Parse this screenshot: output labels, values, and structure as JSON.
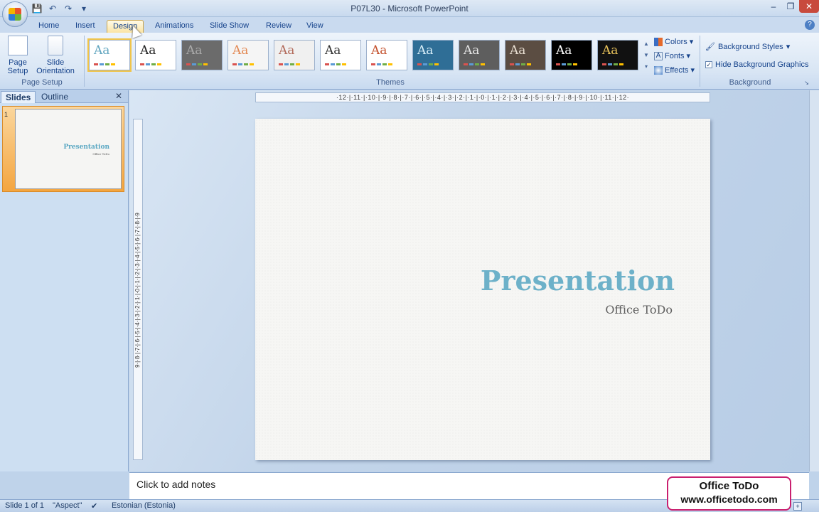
{
  "window": {
    "title": "P07L30 - Microsoft PowerPoint",
    "controls": [
      "minimize",
      "restore",
      "close"
    ]
  },
  "quick_access": [
    "save-icon",
    "undo-icon",
    "redo-icon",
    "customize-icon"
  ],
  "tabs": [
    {
      "label": "Home"
    },
    {
      "label": "Insert"
    },
    {
      "label": "Design",
      "active": true
    },
    {
      "label": "Animations"
    },
    {
      "label": "Slide Show"
    },
    {
      "label": "Review"
    },
    {
      "label": "View"
    }
  ],
  "ribbon": {
    "page_setup": {
      "group_label": "Page Setup",
      "page_setup_label": "Page Setup",
      "orientation_label": "Slide Orientation"
    },
    "themes": {
      "group_label": "Themes",
      "sample": "Aa",
      "selected_index": 0,
      "items": [
        {
          "bg": "#ffffff",
          "fg": "#62a6c0"
        },
        {
          "bg": "#ffffff",
          "fg": "#222222"
        },
        {
          "bg": "#6b6b6b",
          "fg": "#aaaaaa"
        },
        {
          "bg": "#f5f5f5",
          "fg": "#e38a55"
        },
        {
          "bg": "#f0f0f0",
          "fg": "#b26a5a"
        },
        {
          "bg": "#ffffff",
          "fg": "#333333"
        },
        {
          "bg": "#ffffff",
          "fg": "#c3502c"
        },
        {
          "bg": "#2f6e96",
          "fg": "#d8eef8"
        },
        {
          "bg": "#5e5e5e",
          "fg": "#e6e6e6"
        },
        {
          "bg": "#5b4d42",
          "fg": "#e9dfd2"
        },
        {
          "bg": "#000000",
          "fg": "#ffffff"
        },
        {
          "bg": "#111111",
          "fg": "#e8c25a"
        }
      ]
    },
    "colors_label": "Colors",
    "fonts_label": "Fonts",
    "effects_label": "Effects",
    "background": {
      "group_label": "Background",
      "styles_label": "Background Styles",
      "hide_graphics_label": "Hide Background Graphics",
      "hide_graphics_checked": true
    }
  },
  "left_pane": {
    "tab_slides": "Slides",
    "tab_outline": "Outline",
    "thumbnail_number": "1",
    "thumbnail_title": "Presentation",
    "thumbnail_subtitle": "Office ToDo"
  },
  "rulers": {
    "horizontal": "·12·|·11·|·10·|·9·|·8·|·7·|·6·|·5·|·4·|·3·|·2·|·1·|·0·|·1·|·2·|·3·|·4·|·5·|·6·|·7·|·8·|·9·|·10·|·11·|·12·",
    "vertical": "9·|·8·|·7·|·6·|·5·|·4·|·3·|·2·|·1·|·0·|·1·|·2·|·3·|·4·|·5·|·6·|·7·|·8·|·9"
  },
  "slide": {
    "title": "Presentation",
    "subtitle": "Office ToDo"
  },
  "notes_placeholder": "Click to add notes",
  "status": {
    "slide_info": "Slide 1 of 1",
    "theme_name": "\"Aspect\"",
    "language": "Estonian (Estonia)"
  },
  "watermark": {
    "line1": "Office ToDo",
    "line2": "www.officetodo.com"
  },
  "colors": {
    "accent_title": "#6db1c9",
    "tab_active": "#fbe4a4"
  }
}
